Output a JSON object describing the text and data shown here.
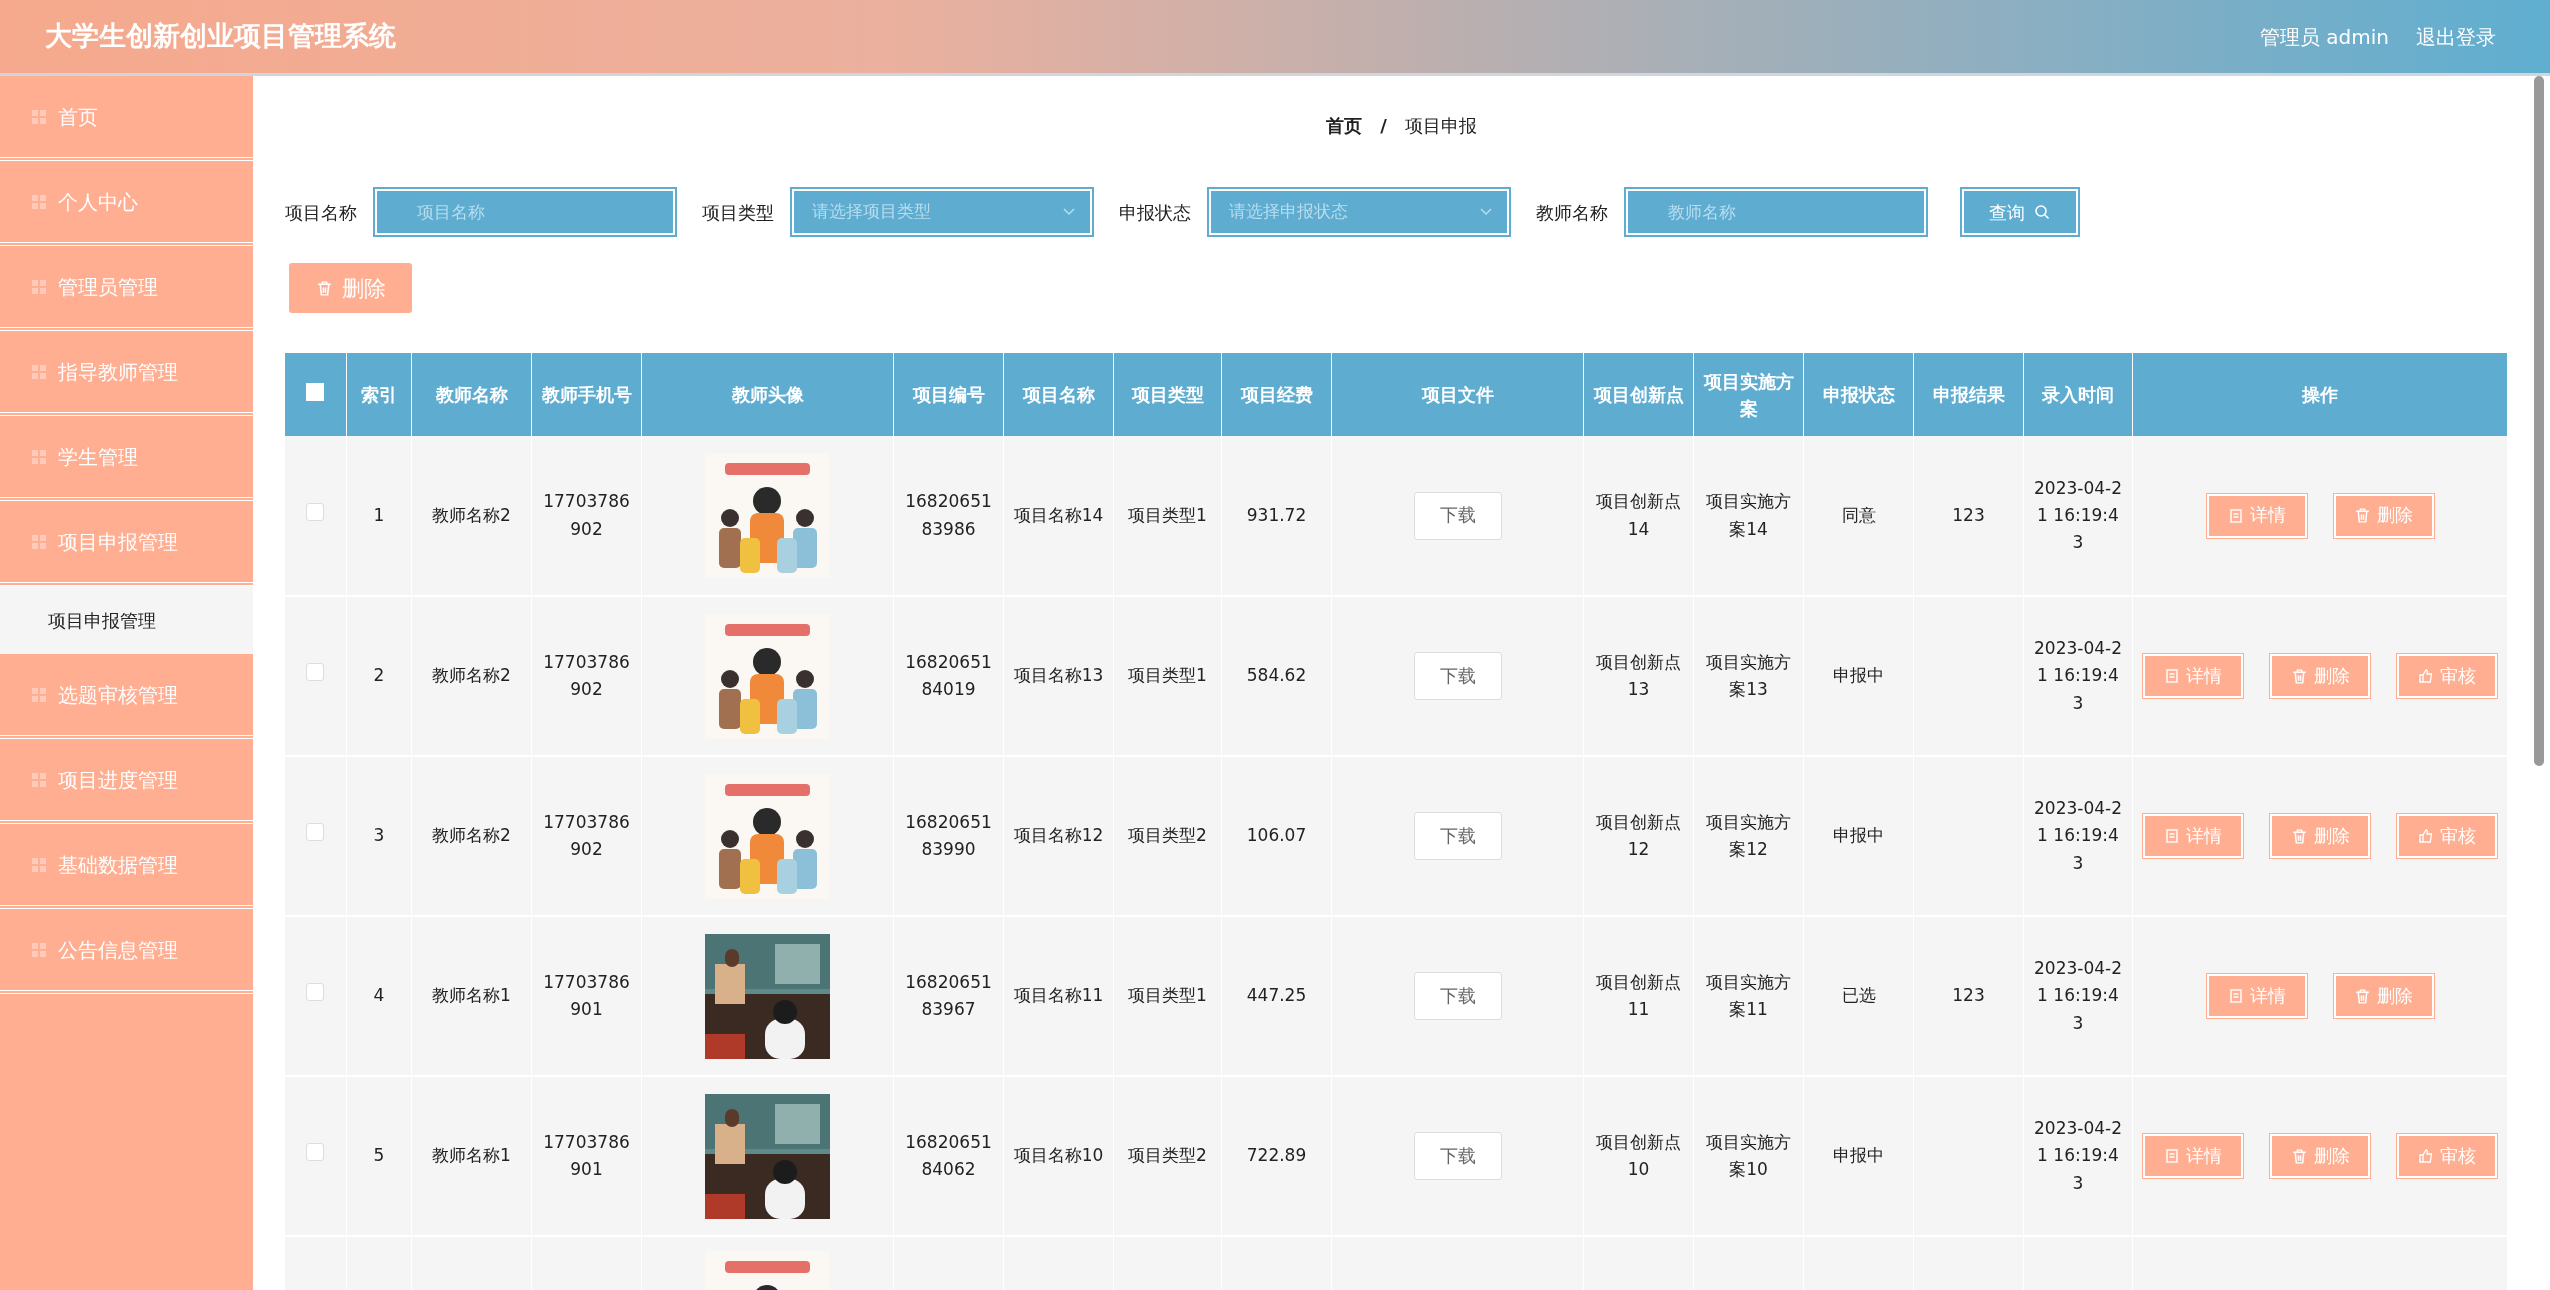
{
  "header": {
    "title": "大学生创新创业项目管理系统",
    "user": "管理员 admin",
    "logout": "退出登录"
  },
  "sidebar": {
    "items": [
      {
        "label": "首页"
      },
      {
        "label": "个人中心"
      },
      {
        "label": "管理员管理"
      },
      {
        "label": "指导教师管理"
      },
      {
        "label": "学生管理"
      },
      {
        "label": "项目申报管理",
        "children": [
          {
            "label": "项目申报管理",
            "selected": true
          }
        ]
      },
      {
        "label": "选题审核管理"
      },
      {
        "label": "项目进度管理"
      },
      {
        "label": "基础数据管理"
      },
      {
        "label": "公告信息管理"
      }
    ]
  },
  "breadcrumb": [
    "首页",
    "项目申报"
  ],
  "breadcrumb_separator": "/",
  "filters": [
    {
      "label": "项目名称",
      "kind": "text",
      "placeholder": "项目名称"
    },
    {
      "label": "项目类型",
      "kind": "select",
      "placeholder": "请选择项目类型"
    },
    {
      "label": "申报状态",
      "kind": "select",
      "placeholder": "请选择申报状态"
    },
    {
      "label": "教师名称",
      "kind": "text",
      "placeholder": "教师名称"
    }
  ],
  "search_button": "查询",
  "delete_button": "删除",
  "table": {
    "columns": [
      "索引",
      "教师名称",
      "教师手机号",
      "教师头像",
      "项目编号",
      "项目名称",
      "项目类型",
      "项目经费",
      "项目文件",
      "项目创新点",
      "项目实施方案",
      "申报状态",
      "申报结果",
      "录入时间",
      "操作"
    ],
    "select_all_checked": false,
    "rows": [
      {
        "checked": false,
        "cells": [
          "1",
          "教师名称2",
          "17703786902",
          null,
          "1682065183986",
          "项目名称14",
          "项目类型1",
          "931.72",
          null,
          "项目创新点14",
          "项目实施方案14",
          "同意",
          "123",
          "2023-04-21 16:19:43"
        ],
        "file_button": "下载",
        "actions": [
          {
            "kind": "detail",
            "label": "详情"
          },
          {
            "kind": "delete",
            "label": "删除"
          }
        ]
      },
      {
        "checked": false,
        "cells": [
          "2",
          "教师名称2",
          "17703786902",
          null,
          "1682065184019",
          "项目名称13",
          "项目类型1",
          "584.62",
          null,
          "项目创新点13",
          "项目实施方案13",
          "申报中",
          "",
          "2023-04-21 16:19:43"
        ],
        "file_button": "下载",
        "actions": [
          {
            "kind": "detail",
            "label": "详情"
          },
          {
            "kind": "delete",
            "label": "删除"
          },
          {
            "kind": "review",
            "label": "审核"
          }
        ]
      },
      {
        "checked": false,
        "cells": [
          "3",
          "教师名称2",
          "17703786902",
          null,
          "1682065183990",
          "项目名称12",
          "项目类型2",
          "106.07",
          null,
          "项目创新点12",
          "项目实施方案12",
          "申报中",
          "",
          "2023-04-21 16:19:43"
        ],
        "file_button": "下载",
        "actions": [
          {
            "kind": "detail",
            "label": "详情"
          },
          {
            "kind": "delete",
            "label": "删除"
          },
          {
            "kind": "review",
            "label": "审核"
          }
        ]
      },
      {
        "checked": false,
        "cells": [
          "4",
          "教师名称1",
          "17703786901",
          null,
          "1682065183967",
          "项目名称11",
          "项目类型1",
          "447.25",
          null,
          "项目创新点11",
          "项目实施方案11",
          "已选",
          "123",
          "2023-04-21 16:19:43"
        ],
        "file_button": "下载",
        "actions": [
          {
            "kind": "detail",
            "label": "详情"
          },
          {
            "kind": "delete",
            "label": "删除"
          }
        ]
      },
      {
        "checked": false,
        "cells": [
          "5",
          "教师名称1",
          "17703786901",
          null,
          "1682065184062",
          "项目名称10",
          "项目类型2",
          "722.89",
          null,
          "项目创新点10",
          "项目实施方案10",
          "申报中",
          "",
          "2023-04-21 16:19:43"
        ],
        "file_button": "下载",
        "actions": [
          {
            "kind": "detail",
            "label": "详情"
          },
          {
            "kind": "delete",
            "label": "删除"
          },
          {
            "kind": "review",
            "label": "审核"
          }
        ]
      },
      {
        "cells": [
          "",
          "",
          "",
          null,
          "",
          "",
          "",
          "",
          null,
          "",
          "",
          "",
          "",
          ""
        ]
      }
    ]
  }
}
